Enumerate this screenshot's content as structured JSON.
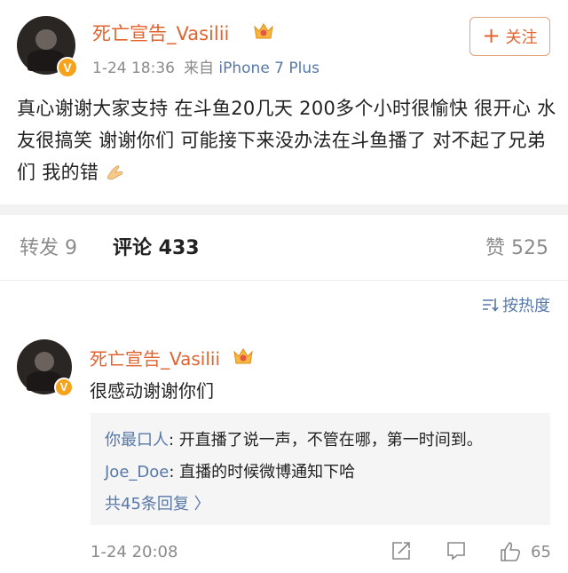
{
  "post": {
    "author": "死亡宣告_Vasilii",
    "time": "1-24 18:36",
    "source_prefix": "来自",
    "device": "iPhone 7 Plus",
    "follow_label": "关注",
    "text": "真心谢谢大家支持 在斗鱼20几天 200多个小时很愉快 很开心 水友很搞笑 谢谢你们 可能接下来没办法在斗鱼播了 对不起了兄弟们 我的错",
    "verified_badge": "V"
  },
  "tabs": {
    "repost": "转发 9",
    "comments": "评论 433",
    "likes": "赞 525"
  },
  "sort_label": "按热度",
  "comment": {
    "author": "死亡宣告_Vasilii",
    "text": "很感动谢谢你们",
    "replies": [
      {
        "user": "你最口人",
        "text": ": 开直播了说一声，不管在哪，第一时间到。"
      },
      {
        "user": "Joe_Doe",
        "text": ": 直播的时候微博通知下哈"
      }
    ],
    "more_replies": "共45条回复 〉",
    "time": "1-24 20:08",
    "like_count": "65"
  },
  "colors": {
    "username": "#e1632f",
    "link": "#5778a8",
    "badge": "#f7a21b"
  },
  "icons": [
    "crown-icon",
    "plus-icon",
    "sort-icon",
    "share-icon",
    "comment-icon",
    "like-icon",
    "folded-hands-emoji",
    "verified-v-icon"
  ]
}
